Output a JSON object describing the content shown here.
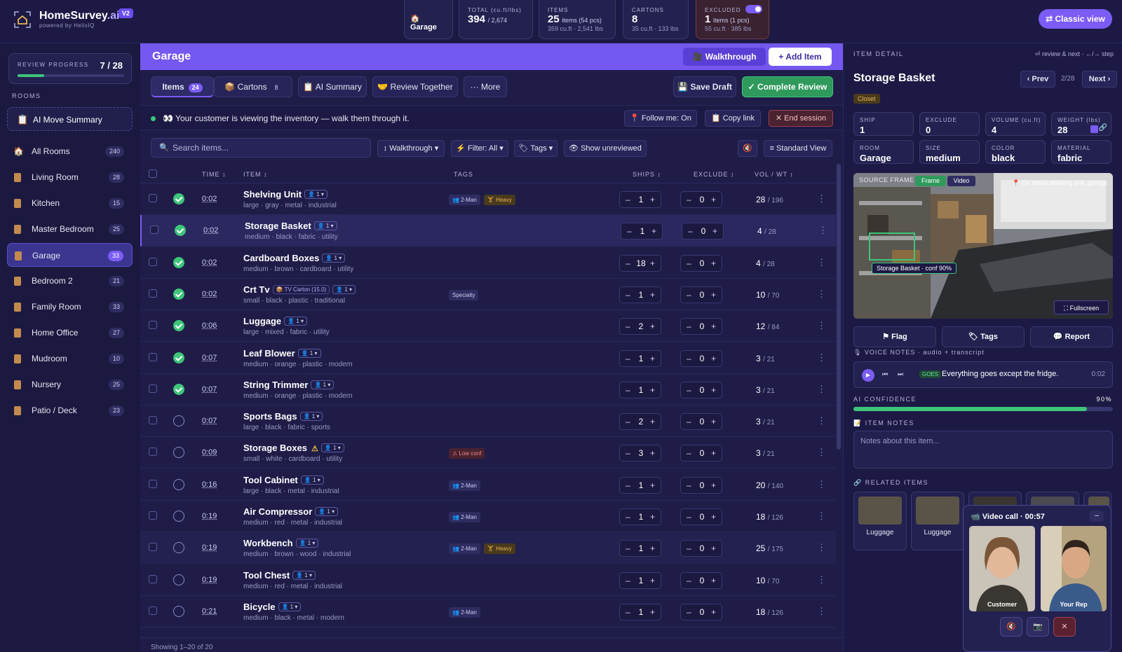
{
  "app": {
    "name_main": "HomeSurvey",
    "name_suffix": ".ai",
    "powered": "powered by HelixIQ",
    "version": "V2"
  },
  "header_stats": {
    "garage": "🏠 Garage",
    "total": {
      "label": "TOTAL (cu.ft/lbs)",
      "value": "394",
      "suffix": "/ 2,674"
    },
    "items": {
      "label": "ITEMS",
      "value": "25",
      "detail": "items (54 pcs)",
      "sub": "359 cu.ft · 2,541 lbs"
    },
    "cartons": {
      "label": "CARTONS",
      "value": "8",
      "sub": "35 cu.ft · 133 lbs"
    },
    "excluded": {
      "label": "EXCLUDED",
      "value": "1",
      "detail": "items (1 pcs)",
      "sub": "55 cu.ft · 385 lbs",
      "toggle_on": true
    }
  },
  "classic_view": "⇄ Classic view",
  "sidebar": {
    "review_progress_label": "REVIEW PROGRESS",
    "review_progress_count": "7 / 28",
    "review_progress_fraction": 0.25,
    "rooms_label": "ROOMS",
    "ai_summary": "AI Move Summary",
    "rooms": [
      {
        "name": "All Rooms",
        "count": "240"
      },
      {
        "name": "Living Room",
        "count": "28"
      },
      {
        "name": "Kitchen",
        "count": "15"
      },
      {
        "name": "Master Bedroom",
        "count": "25"
      },
      {
        "name": "Garage",
        "count": "33",
        "active": true
      },
      {
        "name": "Bedroom 2",
        "count": "21"
      },
      {
        "name": "Family Room",
        "count": "33"
      },
      {
        "name": "Home Office",
        "count": "27"
      },
      {
        "name": "Mudroom",
        "count": "10"
      },
      {
        "name": "Nursery",
        "count": "25"
      },
      {
        "name": "Patio / Deck",
        "count": "23"
      }
    ]
  },
  "main": {
    "title": "Garage",
    "walkthrough_btn": "🎥 Walkthrough",
    "add_item_btn": "+ Add Item",
    "tabs": {
      "items": "Items",
      "items_count": "24",
      "cartons": "📦 Cartons",
      "cartons_count": "8",
      "ai_summary": "📋 AI Summary",
      "review_together": "🤝 Review Together",
      "more": "··· More"
    },
    "save_draft": "💾 Save Draft",
    "complete_review": "✓ Complete Review",
    "banner": {
      "text": "👀 Your customer is viewing the inventory — walk them through it.",
      "follow": "📍 Follow me: On",
      "copy": "📋 Copy link",
      "end": "✕ End session"
    },
    "toolbar": {
      "search_placeholder": "Search items...",
      "walkthrough": "↕ Walkthrough ▾",
      "filter": "⚡ Filter: All ▾",
      "tags": "🏷 Tags ▾",
      "unreviewed": "👁 Show unreviewed",
      "standard_view": "≡ Standard View"
    },
    "columns": {
      "time": "TIME ↕",
      "item": "ITEM ↕",
      "tags": "TAGS",
      "ships": "SHIPS ↕",
      "exclude": "EXCLUDE ↕",
      "volwt": "VOL / WT ↕"
    },
    "rows": [
      {
        "time": "0:02",
        "name": "Shelving Unit",
        "attrs": "large · gray · metal · industrial",
        "tags": [
          "2-Man",
          "Heavy"
        ],
        "ships": "1",
        "exclude": "0",
        "vol": "28",
        "wt": "/ 196",
        "done": true
      },
      {
        "time": "0:02",
        "name": "Storage Basket",
        "attrs": "medium · black · fabric · utility",
        "tags": [],
        "ships": "1",
        "exclude": "0",
        "vol": "4",
        "wt": "/ 28",
        "done": true,
        "selected": true
      },
      {
        "time": "0:02",
        "name": "Cardboard Boxes",
        "attrs": "medium · brown · cardboard · utility",
        "tags": [],
        "ships": "18",
        "exclude": "0",
        "vol": "4",
        "wt": "/ 28",
        "done": true
      },
      {
        "time": "0:02",
        "name": "Crt Tv",
        "carton": "📦 TV Carton (15.0)",
        "attrs": "small · black · plastic · traditional",
        "tags": [
          "Specialty"
        ],
        "ships": "1",
        "exclude": "0",
        "vol": "10",
        "wt": "/ 70",
        "done": true
      },
      {
        "time": "0:06",
        "name": "Luggage",
        "attrs": "large · mixed · fabric · utility",
        "tags": [],
        "ships": "2",
        "exclude": "0",
        "vol": "12",
        "wt": "/ 84",
        "done": true
      },
      {
        "time": "0:07",
        "name": "Leaf Blower",
        "attrs": "medium · orange · plastic · modern",
        "tags": [],
        "ships": "1",
        "exclude": "0",
        "vol": "3",
        "wt": "/ 21",
        "done": true
      },
      {
        "time": "0:07",
        "name": "String Trimmer",
        "attrs": "medium · orange · plastic · modern",
        "tags": [],
        "ships": "1",
        "exclude": "0",
        "vol": "3",
        "wt": "/ 21",
        "done": true
      },
      {
        "time": "0:07",
        "name": "Sports Bags",
        "attrs": "large · black · fabric · sports",
        "tags": [],
        "ships": "2",
        "exclude": "0",
        "vol": "3",
        "wt": "/ 21",
        "done": false
      },
      {
        "time": "0:09",
        "name": "Storage Boxes",
        "warn": "⚠",
        "attrs": "small · white · cardboard · utility",
        "tags": [
          "⚠ Low conf"
        ],
        "ships": "3",
        "exclude": "0",
        "vol": "3",
        "wt": "/ 21",
        "done": false
      },
      {
        "time": "0:16",
        "name": "Tool Cabinet",
        "attrs": "large · black · metal · industrial",
        "tags": [
          "2-Man"
        ],
        "ships": "1",
        "exclude": "0",
        "vol": "20",
        "wt": "/ 140",
        "done": false
      },
      {
        "time": "0:19",
        "name": "Air Compressor",
        "attrs": "medium · red · metal · industrial",
        "tags": [
          "2-Man"
        ],
        "ships": "1",
        "exclude": "0",
        "vol": "18",
        "wt": "/ 126",
        "done": false
      },
      {
        "time": "0:19",
        "name": "Workbench",
        "attrs": "medium · brown · wood · industrial",
        "tags": [
          "2-Man",
          "Heavy"
        ],
        "ships": "1",
        "exclude": "0",
        "vol": "25",
        "wt": "/ 175",
        "done": false
      },
      {
        "time": "0:19",
        "name": "Tool Chest",
        "attrs": "medium · red · metal · industrial",
        "tags": [],
        "ships": "1",
        "exclude": "0",
        "vol": "10",
        "wt": "/ 70",
        "done": false
      },
      {
        "time": "0:21",
        "name": "Bicycle",
        "attrs": "medium · black · metal · modern",
        "tags": [
          "2-Man"
        ],
        "ships": "1",
        "exclude": "0",
        "vol": "18",
        "wt": "/ 126",
        "done": false
      }
    ],
    "footer": "Showing 1–20 of 20"
  },
  "detail": {
    "header": "ITEM DETAIL",
    "hint": "⏎ review & next · ←/→ step",
    "name": "Storage Basket",
    "prev": "‹ Prev",
    "pos": "2/28",
    "next": "Next ›",
    "location_tag": "Closet",
    "fields": [
      {
        "label": "SHIP",
        "value": "1"
      },
      {
        "label": "EXCLUDE",
        "value": "0"
      },
      {
        "label": "VOLUME (cu.ft)",
        "value": "4"
      },
      {
        "label": "WEIGHT (lbs)",
        "value": "28"
      },
      {
        "label": "ROOM",
        "value": "Garage"
      },
      {
        "label": "SIZE",
        "value": "medium"
      },
      {
        "label": "COLOR",
        "value": "black"
      },
      {
        "label": "MATERIAL",
        "value": "fabric"
      }
    ],
    "source_frame": "SOURCE FRAME",
    "frame_btn": "Frame",
    "video_btn": "Video",
    "frame_location": "📍 On metal shelving unit, garage",
    "detection_label": "Storage Basket · conf 90%",
    "fullscreen": "⛶ Fullscreen",
    "flag": "⚑ Flag",
    "tags": "🏷 Tags",
    "report": "💬 Report",
    "voice_header": "🎙 VOICE NOTES · audio + transcript",
    "voice_tag": "GOES",
    "voice_text": "Everything goes except the fridge.",
    "voice_dur": "0:02",
    "ai_conf_label": "AI CONFIDENCE",
    "ai_conf_value": "90%",
    "ai_conf_fraction": 0.9,
    "notes_label": "📝 ITEM NOTES",
    "notes_placeholder": "Notes about this item...",
    "related_label": "🔗 RELATED ITEMS",
    "related": [
      "Luggage",
      "Luggage"
    ]
  },
  "video_call": {
    "title": "📹 Video call · 00:57",
    "min": "–",
    "customer": "Customer",
    "rep": "Your Rep"
  }
}
